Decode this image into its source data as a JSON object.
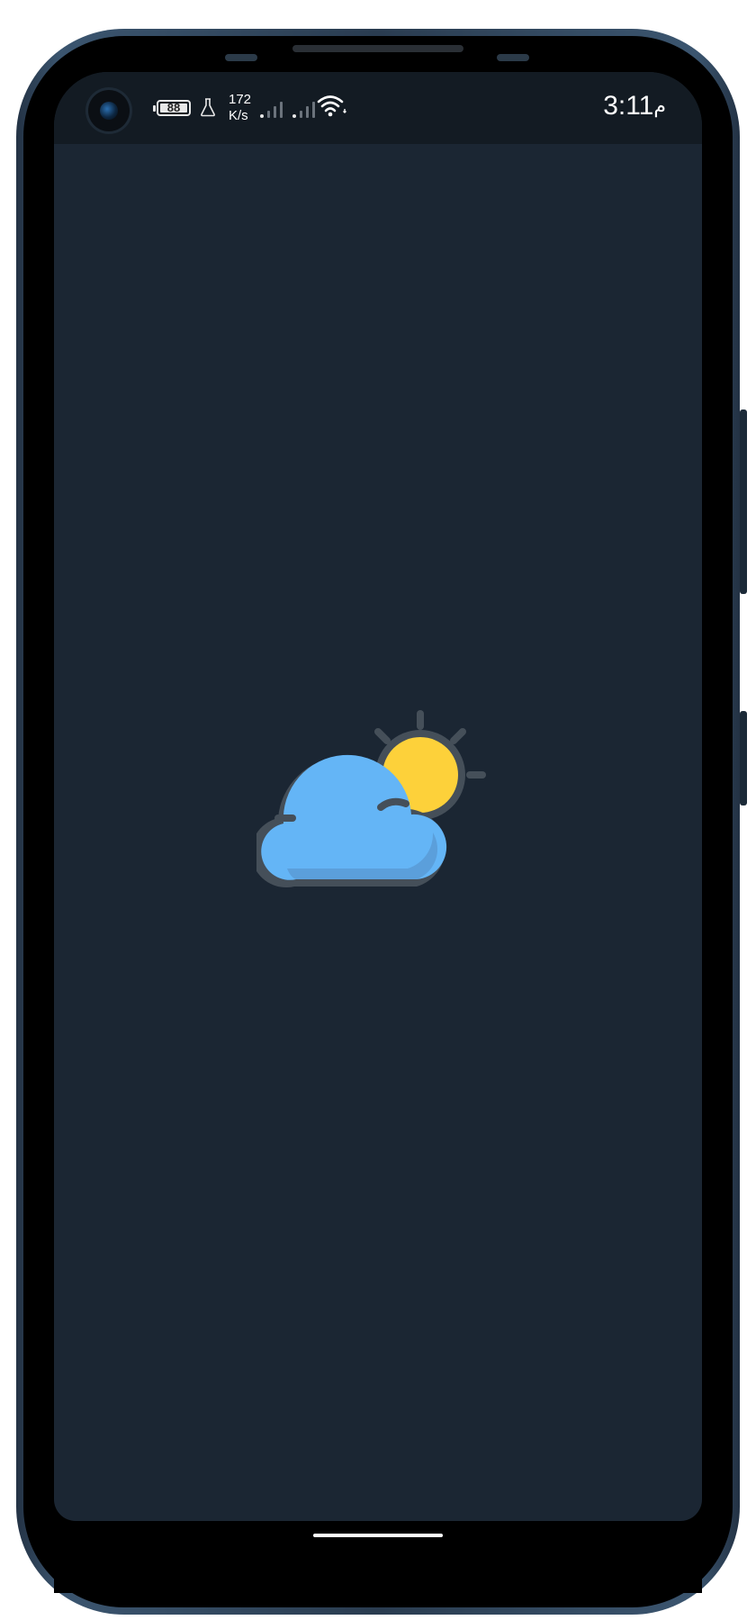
{
  "status_bar": {
    "battery_level": "88",
    "network_speed_value": "172",
    "network_speed_unit": "K/s",
    "time": "3:11",
    "ampm": "م"
  },
  "colors": {
    "screen_background": "#1b2633",
    "status_bar_background": "#131b23",
    "cloud": "#64b5f6",
    "sun": "#fdd13a",
    "outline": "#454f59"
  },
  "icons": {
    "app_logo": "partly-cloudy-weather-icon"
  }
}
